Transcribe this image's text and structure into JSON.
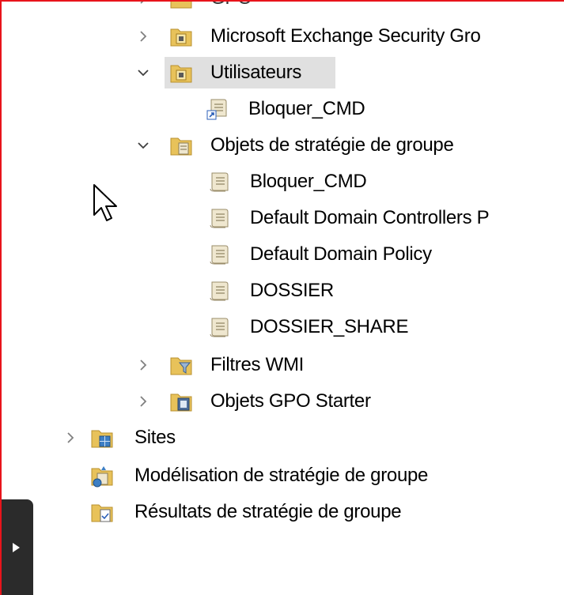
{
  "tree": {
    "partial_top_label": "GPO",
    "items": [
      {
        "label": "Microsoft Exchange Security Gro",
        "icon": "folder-ou-icon",
        "expand": "collapsed"
      },
      {
        "label": "Utilisateurs",
        "icon": "folder-ou-icon",
        "expand": "expanded",
        "selected": true
      },
      {
        "label": "Bloquer_CMD",
        "icon": "gpo-link-icon",
        "expand": "none"
      },
      {
        "label": "Objets de stratégie de groupe",
        "icon": "gpo-container-icon",
        "expand": "expanded"
      },
      {
        "label": "Bloquer_CMD",
        "icon": "gpo-scroll-icon",
        "expand": "none"
      },
      {
        "label": "Default Domain Controllers P",
        "icon": "gpo-scroll-icon",
        "expand": "none"
      },
      {
        "label": "Default Domain Policy",
        "icon": "gpo-scroll-icon",
        "expand": "none"
      },
      {
        "label": "DOSSIER",
        "icon": "gpo-scroll-icon",
        "expand": "none"
      },
      {
        "label": "DOSSIER_SHARE",
        "icon": "gpo-scroll-icon",
        "expand": "none"
      },
      {
        "label": "Filtres WMI",
        "icon": "wmi-filter-icon",
        "expand": "collapsed"
      },
      {
        "label": "Objets GPO Starter",
        "icon": "starter-gpo-icon",
        "expand": "collapsed"
      },
      {
        "label": "Sites",
        "icon": "sites-icon",
        "expand": "collapsed"
      },
      {
        "label": "Modélisation de stratégie de groupe",
        "icon": "gp-modeling-icon",
        "expand": "none"
      },
      {
        "label": "Résultats de stratégie de groupe",
        "icon": "gp-results-icon",
        "expand": "none"
      }
    ]
  },
  "colors": {
    "frame_border": "#e8141b",
    "selection": "#e0e0e0",
    "folder": "#e8c25a",
    "side_tab": "#2b2b2b"
  }
}
